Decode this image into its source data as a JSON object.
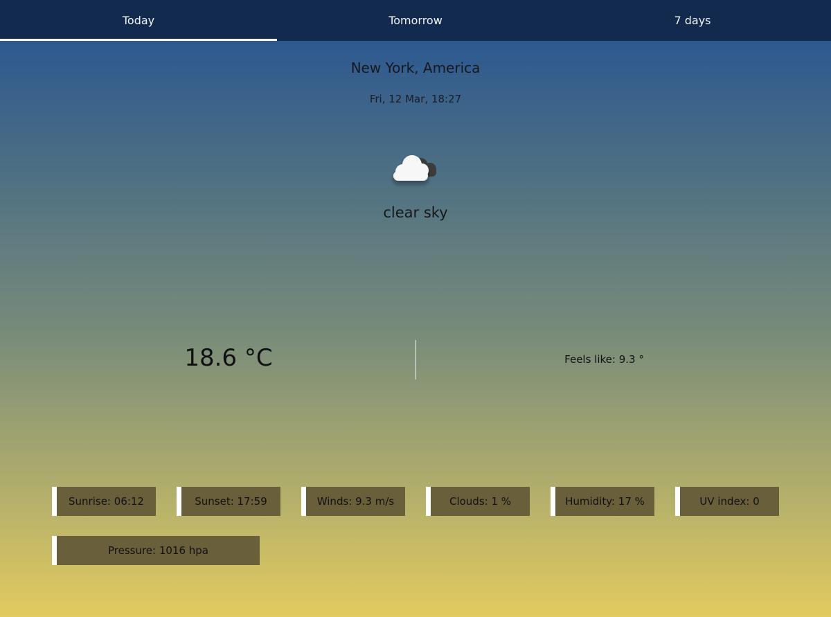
{
  "tabs": [
    "Today",
    "Tomorrow",
    "7 days"
  ],
  "location": "New York, America",
  "datetime": "Fri, 12 Mar, 18:27",
  "weather": {
    "icon": "cloud-icon",
    "description": "clear sky",
    "temperature": "18.6 °C",
    "feels_like": "Feels like: 9.3 °"
  },
  "stats": {
    "sunrise": "Sunrise: 06:12",
    "sunset": "Sunset: 17:59",
    "winds": "Winds: 9.3 m/s",
    "clouds": "Clouds: 1 %",
    "humidity": "Humidity: 17 %",
    "uv_index": "UV index: 0",
    "pressure": "Pressure: 1016 hpa"
  },
  "colors": {
    "tab_bar": "#122a4d",
    "accent": "#ffffff",
    "gradient_top": "#2c5890",
    "gradient_bottom": "#e2cb60",
    "stat_card": "#695f3a"
  }
}
